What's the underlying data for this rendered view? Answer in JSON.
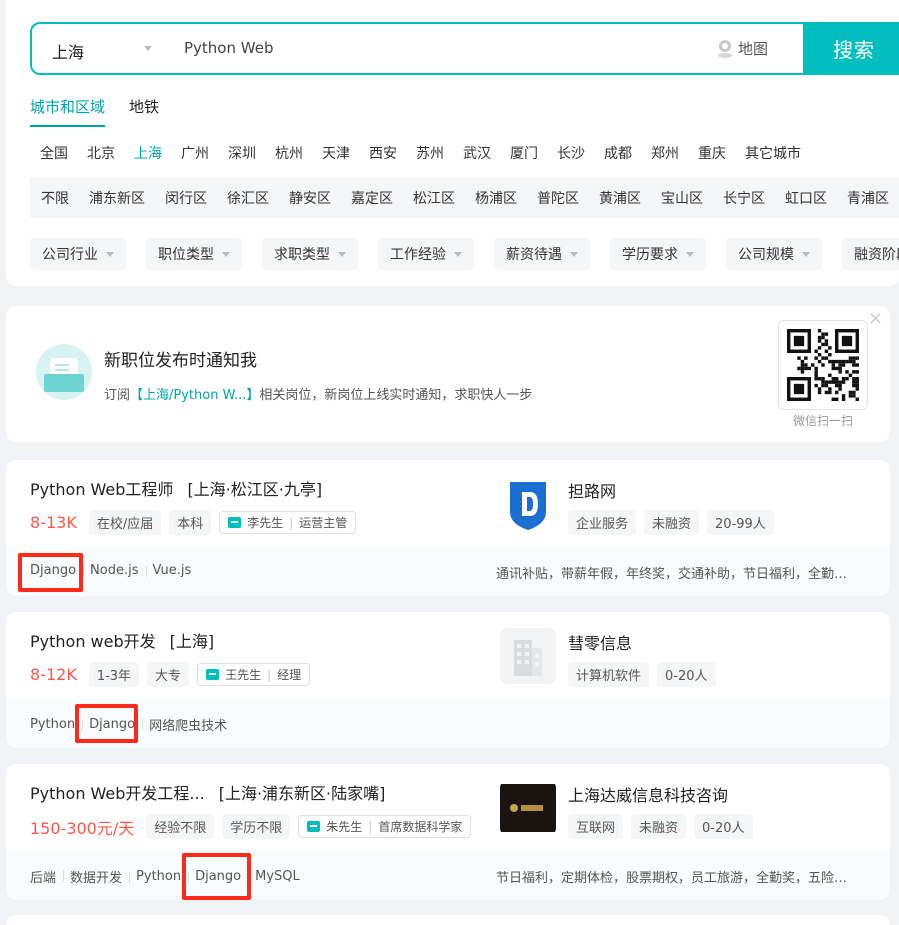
{
  "search": {
    "city": "上海",
    "query": "Python Web",
    "map_label": "地图",
    "button_label": "搜索"
  },
  "region_tabs": [
    "城市和区域",
    "地铁"
  ],
  "cities": [
    "全国",
    "北京",
    "上海",
    "广州",
    "深圳",
    "杭州",
    "天津",
    "西安",
    "苏州",
    "武汉",
    "厦门",
    "长沙",
    "成都",
    "郑州",
    "重庆",
    "其它城市"
  ],
  "districts": [
    "不限",
    "浦东新区",
    "闵行区",
    "徐汇区",
    "静安区",
    "嘉定区",
    "松江区",
    "杨浦区",
    "普陀区",
    "黄浦区",
    "宝山区",
    "长宁区",
    "虹口区",
    "青浦区"
  ],
  "filters": [
    "公司行业",
    "职位类型",
    "求职类型",
    "工作经验",
    "薪资待遇",
    "学历要求",
    "公司规模",
    "融资阶段"
  ],
  "subscribe": {
    "title": "新职位发布时通知我",
    "desc_prefix": "订阅",
    "desc_highlight": "【上海/Python W...】",
    "desc_suffix": "相关岗位，新岗位上线实时通知，求职快人一步",
    "qr_label": "微信扫一扫",
    "close": "×"
  },
  "jobs": [
    {
      "title": "Python Web工程师",
      "area": "[上海·松江区·九亭]",
      "salary": "8-13K",
      "tags": [
        "在校/应届",
        "本科"
      ],
      "recruiter_name": "李先生",
      "recruiter_title": "运营主管",
      "company": "担路网",
      "company_tags": [
        "企业服务",
        "未融资",
        "20-99人"
      ],
      "skills": [
        "Django",
        "Node.js",
        "Vue.js"
      ],
      "welfare": "通讯补贴，带薪年假，年终奖，交通补助，节日福利，全勤奖，五险一金"
    },
    {
      "title": "Python web开发",
      "area": "[上海]",
      "salary": "8-12K",
      "tags": [
        "1-3年",
        "大专"
      ],
      "recruiter_name": "王先生",
      "recruiter_title": "经理",
      "company": "彗零信息",
      "company_tags": [
        "计算机软件",
        "0-20人"
      ],
      "skills": [
        "Python",
        "Django",
        "网络爬虫技术"
      ],
      "welfare": ""
    },
    {
      "title": "Python Web开发工程...",
      "area": "[上海·浦东新区·陆家嘴]",
      "salary": "150-300元/天",
      "tags": [
        "经验不限",
        "学历不限"
      ],
      "recruiter_name": "朱先生",
      "recruiter_title": "首席数据科学家",
      "company": "上海达威信息科技咨询",
      "company_tags": [
        "互联网",
        "未融资",
        "0-20人"
      ],
      "skills": [
        "后端",
        "数据开发",
        "Python",
        "Django",
        "MySQL"
      ],
      "welfare": "节日福利，定期体检，股票期权，员工旅游，全勤奖，五险一金"
    }
  ],
  "colors": {
    "brand": "#00bebd",
    "active_text": "#00a6a7",
    "salary": "#fe574a",
    "highlight_box": "#ff2a1a"
  },
  "icons": [
    "location-pin-icon",
    "dropdown-caret-icon",
    "mail-subscribe-icon",
    "qr-code-icon",
    "close-icon",
    "chat-icon",
    "company-logo"
  ]
}
